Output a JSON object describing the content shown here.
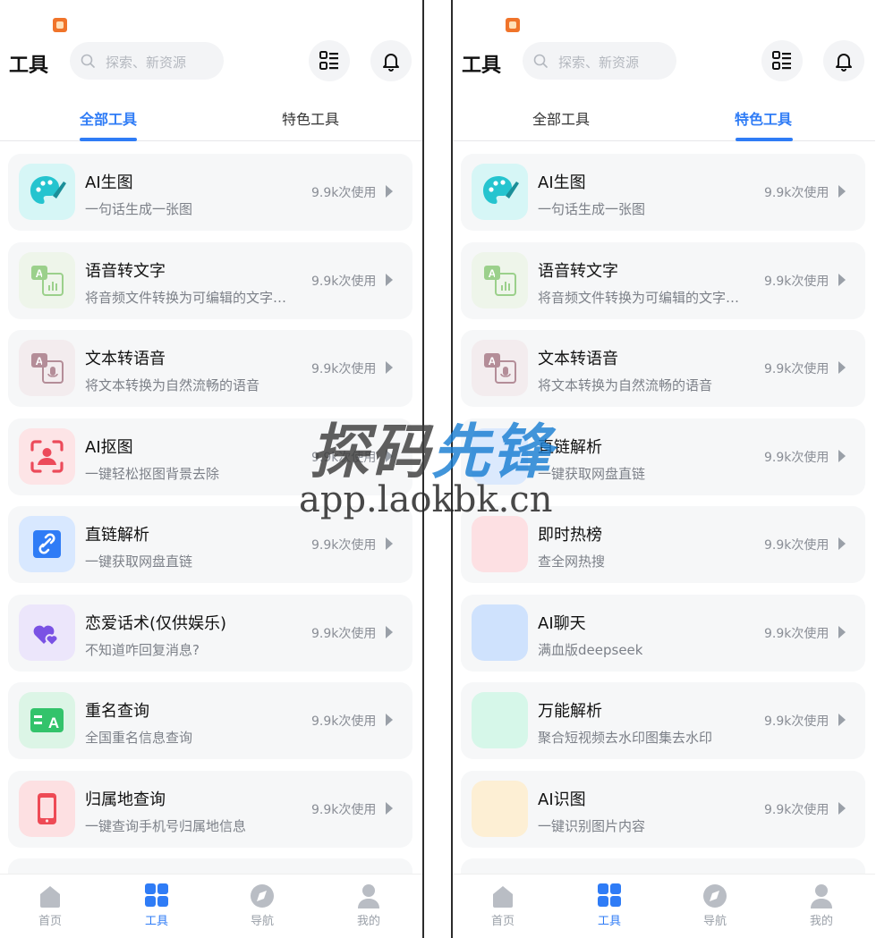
{
  "app": {
    "title": "工具",
    "search_placeholder": "探索、新资源",
    "tabs": [
      "全部工具",
      "特色工具"
    ],
    "usage_text": "9.9k次使用",
    "accent_color": "#2f7cf6"
  },
  "screens": [
    {
      "active_tab": 0,
      "cards": [
        {
          "title": "AI生图",
          "desc": "一句话生成一张图",
          "icon": "palette-icon",
          "bg": "#d6f6f6",
          "fg": "#25c4cf"
        },
        {
          "title": "语音转文字",
          "desc": "将音频文件转换为可编辑的文字…",
          "icon": "speech-to-text-icon",
          "bg": "#eef5ea",
          "fg": "#9bd08b"
        },
        {
          "title": "文本转语音",
          "desc": "将文本转换为自然流畅的语音",
          "icon": "text-to-speech-icon",
          "bg": "#f3ecee",
          "fg": "#b48d98"
        },
        {
          "title": "AI抠图",
          "desc": "一键轻松抠图背景去除",
          "icon": "portrait-cutout-icon",
          "bg": "#fde4e6",
          "fg": "#ec4a5a"
        },
        {
          "title": "直链解析",
          "desc": "一键获取网盘直链",
          "icon": "link-icon",
          "bg": "#d8e8ff",
          "fg": "#2f7cf6"
        },
        {
          "title": "恋爱话术(仅供娱乐)",
          "desc": "不知道咋回复消息?",
          "icon": "hearts-icon",
          "bg": "#ece6fb",
          "fg": "#7a52e4"
        },
        {
          "title": "重名查询",
          "desc": "全国重名信息查询",
          "icon": "name-query-icon",
          "bg": "#dcf5e6",
          "fg": "#33c36b"
        },
        {
          "title": "归属地查询",
          "desc": "一键查询手机号归属地信息",
          "icon": "phone-icon",
          "bg": "#fde0e2",
          "fg": "#ee4a55"
        }
      ]
    },
    {
      "active_tab": 1,
      "cards": [
        {
          "title": "AI生图",
          "desc": "一句话生成一张图",
          "icon": "palette-icon",
          "bg": "#d6f6f6",
          "fg": "#25c4cf"
        },
        {
          "title": "语音转文字",
          "desc": "将音频文件转换为可编辑的文字…",
          "icon": "speech-to-text-icon",
          "bg": "#eef5ea",
          "fg": "#9bd08b"
        },
        {
          "title": "文本转语音",
          "desc": "将文本转换为自然流畅的语音",
          "icon": "text-to-speech-icon",
          "bg": "#f3ecee",
          "fg": "#b48d98"
        },
        {
          "title": "直链解析",
          "desc": "一键获取网盘直链",
          "icon": "blank-icon",
          "bg": "#dbe9fd",
          "fg": "#dbe9fd"
        },
        {
          "title": "即时热榜",
          "desc": "查全网热搜",
          "icon": "blank-icon",
          "bg": "#fde0e3",
          "fg": "#fde0e3"
        },
        {
          "title": "AI聊天",
          "desc": "满血版deepseek",
          "icon": "blank-icon",
          "bg": "#cfe2fd",
          "fg": "#cfe2fd"
        },
        {
          "title": "万能解析",
          "desc": "聚合短视频去水印图集去水印",
          "icon": "blank-icon",
          "bg": "#d6f7e9",
          "fg": "#d6f7e9"
        },
        {
          "title": "AI识图",
          "desc": "一键识别图片内容",
          "icon": "blank-icon",
          "bg": "#fdefd4",
          "fg": "#fdefd4"
        }
      ]
    }
  ],
  "bottom_nav": [
    {
      "label": "首页",
      "icon": "home-icon"
    },
    {
      "label": "工具",
      "icon": "tools-grid-icon"
    },
    {
      "label": "导航",
      "icon": "compass-icon"
    },
    {
      "label": "我的",
      "icon": "user-icon"
    }
  ],
  "bottom_nav_active": 1,
  "watermark": {
    "main_left": "探码",
    "main_right": "先锋",
    "url": "app.laokbk.cn"
  }
}
